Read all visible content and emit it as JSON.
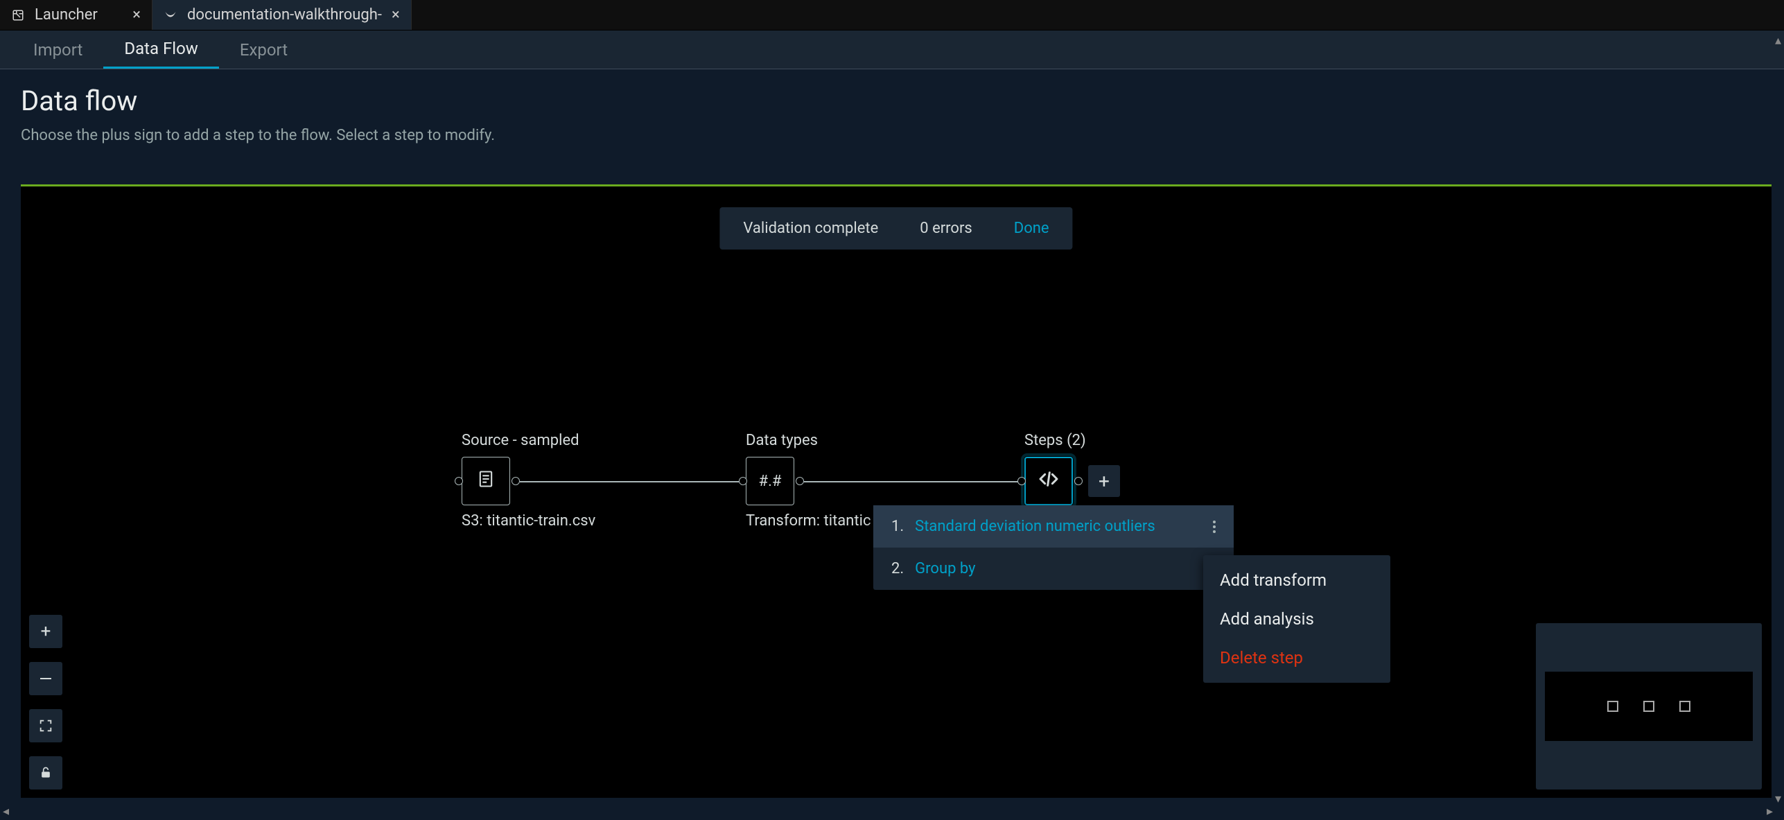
{
  "tabs": [
    {
      "label": "Launcher",
      "icon": "launcher-icon"
    },
    {
      "label": "documentation-walkthrough-",
      "icon": "app-icon"
    }
  ],
  "nav": {
    "items": [
      {
        "label": "Import",
        "active": false
      },
      {
        "label": "Data Flow",
        "active": true
      },
      {
        "label": "Export",
        "active": false
      }
    ]
  },
  "header": {
    "title": "Data flow",
    "subtitle": "Choose the plus sign to add a step to the flow. Select a step to modify."
  },
  "toast": {
    "status": "Validation complete",
    "errors": "0 errors",
    "action": "Done"
  },
  "flow": {
    "nodes": [
      {
        "topLabel": "Source - sampled",
        "bottomLabel": "S3: titantic-train.csv",
        "glyph": "file"
      },
      {
        "topLabel": "Data types",
        "bottomLabel": "Transform: titantic-t",
        "glyph": "#.#"
      },
      {
        "topLabel": "Steps (2)",
        "bottomLabel": "",
        "glyph": "code",
        "selected": true
      }
    ]
  },
  "stepsPopover": {
    "items": [
      {
        "index": "1.",
        "name": "Standard deviation numeric outliers",
        "highlight": true
      },
      {
        "index": "2.",
        "name": "Group by",
        "highlight": false
      }
    ]
  },
  "contextMenu": {
    "items": [
      {
        "label": "Add transform",
        "danger": false
      },
      {
        "label": "Add analysis",
        "danger": false
      },
      {
        "label": "Delete step",
        "danger": true
      }
    ]
  }
}
